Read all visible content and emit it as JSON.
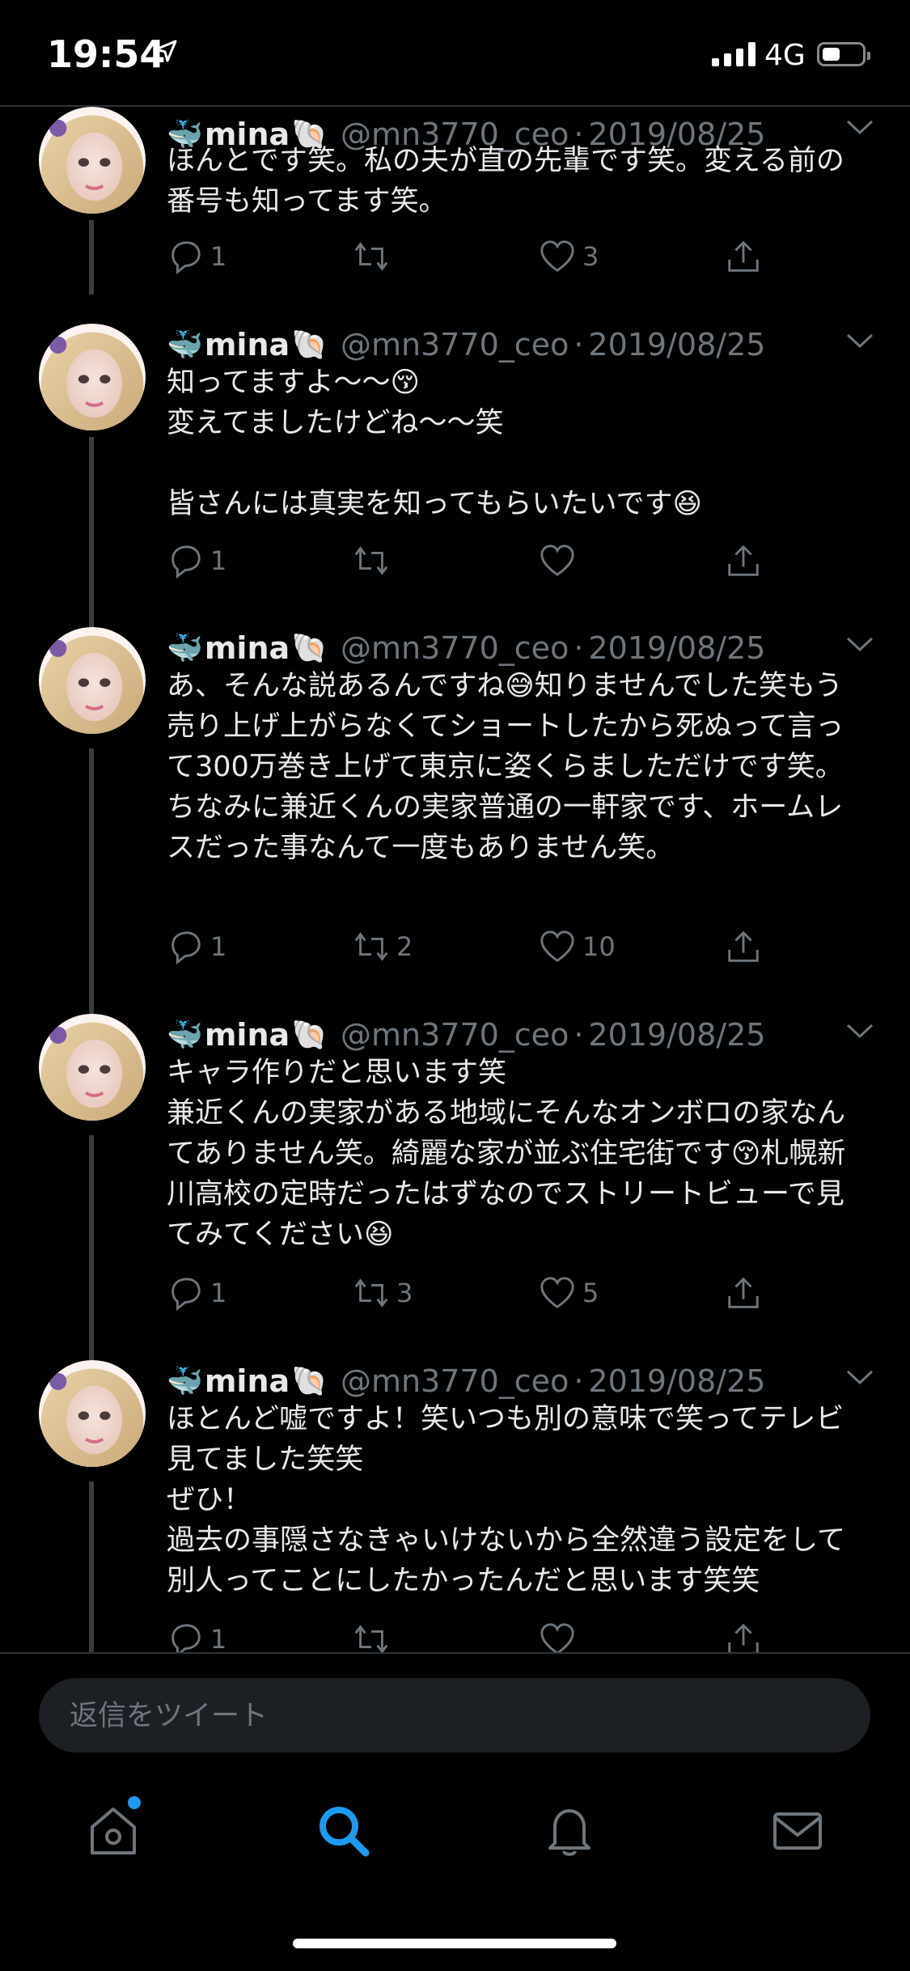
{
  "status_bar": {
    "time": "19:54",
    "network": "4G",
    "battery_level": 0.45
  },
  "colors": {
    "accent": "#1d9bf0",
    "text": "#e7e9ea",
    "secondary": "#6e767d",
    "background": "#000000"
  },
  "tweets": [
    {
      "name_prefix_emoji": "🐳",
      "name": "mina",
      "name_suffix_emoji": "🐚",
      "handle": "@mn3770_ceo",
      "date": "2019/08/25",
      "text": "ほんとです笑。私の夫が直の先輩です笑。変える前の番号も知ってます笑。",
      "replies": "1",
      "retweets": "",
      "likes": "3"
    },
    {
      "name_prefix_emoji": "🐳",
      "name": "mina",
      "name_suffix_emoji": "🐚",
      "handle": "@mn3770_ceo",
      "date": "2019/08/25",
      "text": "知ってますよ〜〜😚\n変えてましたけどね〜〜笑\n\n皆さんには真実を知ってもらいたいです😆",
      "replies": "1",
      "retweets": "",
      "likes": ""
    },
    {
      "name_prefix_emoji": "🐳",
      "name": "mina",
      "name_suffix_emoji": "🐚",
      "handle": "@mn3770_ceo",
      "date": "2019/08/25",
      "text": "あ、そんな説あるんですね😅知りませんでした笑もう売り上げ上がらなくてショートしたから死ぬって言って300万巻き上げて東京に姿くらましただけです笑。ちなみに兼近くんの実家普通の一軒家です、ホームレスだった事なんて一度もありません笑。",
      "replies": "1",
      "retweets": "2",
      "likes": "10"
    },
    {
      "name_prefix_emoji": "🐳",
      "name": "mina",
      "name_suffix_emoji": "🐚",
      "handle": "@mn3770_ceo",
      "date": "2019/08/25",
      "text": "キャラ作りだと思います笑\n兼近くんの実家がある地域にそんなオンボロの家なんてありません笑。綺麗な家が並ぶ住宅街です😚札幌新川高校の定時だったはずなのでストリートビューで見てみてください😆",
      "replies": "1",
      "retweets": "3",
      "likes": "5"
    },
    {
      "name_prefix_emoji": "🐳",
      "name": "mina",
      "name_suffix_emoji": "🐚",
      "handle": "@mn3770_ceo",
      "date": "2019/08/25",
      "text": "ほとんど嘘ですよ！笑いつも別の意味で笑ってテレビ見てました笑笑\nぜひ！\n過去の事隠さなきゃいけないから全然違う設定をして別人ってことにしたかったんだと思います笑笑",
      "replies": "1",
      "retweets": "",
      "likes": ""
    }
  ],
  "reply_box": {
    "placeholder": "返信をツイート"
  },
  "tab_bar": [
    {
      "icon": "home-icon",
      "active": false,
      "badge": true
    },
    {
      "icon": "search-icon",
      "active": true,
      "badge": false
    },
    {
      "icon": "bell-icon",
      "active": false,
      "badge": false
    },
    {
      "icon": "mail-icon",
      "active": false,
      "badge": false
    }
  ]
}
